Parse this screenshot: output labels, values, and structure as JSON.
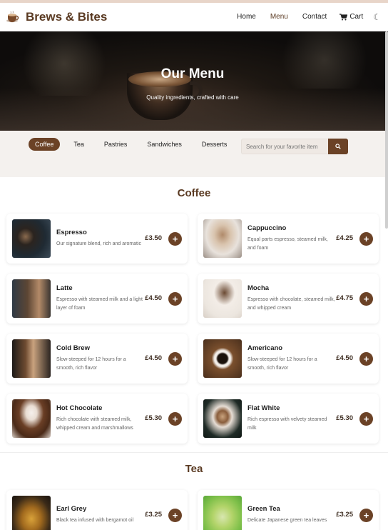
{
  "brand": {
    "name": "Brews & Bites",
    "logo_icon": "coffee-cup-icon"
  },
  "nav": {
    "links": [
      {
        "label": "Home",
        "active": false
      },
      {
        "label": "Menu",
        "active": true
      },
      {
        "label": "Contact",
        "active": false
      }
    ],
    "cart_label": "Cart",
    "theme_icon": "moon-icon"
  },
  "hero": {
    "title": "Our Menu",
    "subtitle": "Quality ingredients, crafted with care"
  },
  "categories": {
    "tabs": [
      "Coffee",
      "Tea",
      "Pastries",
      "Sandwiches",
      "Desserts"
    ],
    "active": "Coffee",
    "search_placeholder": "Search for your favorite item",
    "search_icon": "search-icon"
  },
  "sections": [
    {
      "title": "Coffee",
      "items": [
        {
          "name": "Espresso",
          "desc": "Our signature blend, rich and aromatic",
          "price": "£3.50"
        },
        {
          "name": "Cappuccino",
          "desc": "Equal parts espresso, steamed milk, and foam",
          "price": "£4.25"
        },
        {
          "name": "Latte",
          "desc": "Espresso with steamed milk and a light layer of foam",
          "price": "£4.50"
        },
        {
          "name": "Mocha",
          "desc": "Espresso with chocolate, steamed milk, and whipped cream",
          "price": "£4.75"
        },
        {
          "name": "Cold Brew",
          "desc": "Slow-steeped for 12 hours for a smooth, rich flavor",
          "price": "£4.50"
        },
        {
          "name": "Americano",
          "desc": "Slow-steeped for 12 hours for a smooth, rich flavor",
          "price": "£4.50"
        },
        {
          "name": "Hot Chocolate",
          "desc": "Rich chocolate with steamed milk, whipped cream and marshmallows",
          "price": "£5.30"
        },
        {
          "name": "Flat White",
          "desc": "Rich espresso with velvety steamed milk",
          "price": "£5.30"
        }
      ]
    },
    {
      "title": "Tea",
      "items": [
        {
          "name": "Earl Grey",
          "desc": "Black tea infused with bergamot oil",
          "price": "£3.25"
        },
        {
          "name": "Green Tea",
          "desc": "Delicate Japanese green tea leaves",
          "price": "£3.25"
        }
      ]
    }
  ],
  "colors": {
    "brand": "#6b4226",
    "title": "#5a3a22"
  }
}
